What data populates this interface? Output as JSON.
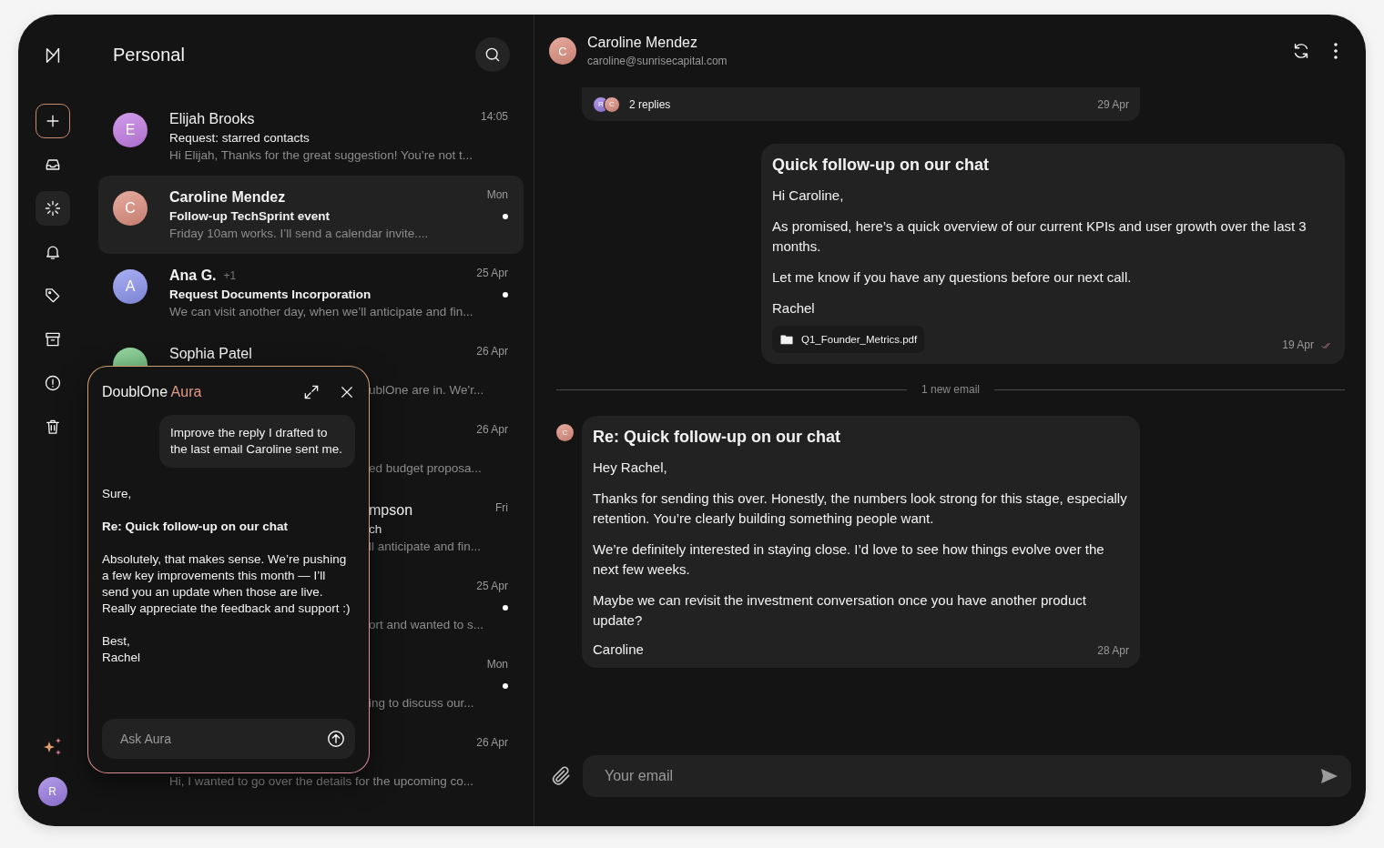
{
  "sidebar": {
    "compose": {
      "selected": false
    },
    "items": [
      {
        "selected": false
      },
      {
        "selected": true
      },
      {
        "selected": false
      },
      {
        "selected": false
      },
      {
        "selected": false
      },
      {
        "selected": false
      },
      {
        "selected": false
      }
    ],
    "user": {
      "letter": "R",
      "color": "#9a7be3"
    }
  },
  "mail_list": {
    "title": "Personal",
    "rows": [
      {
        "avatar": {
          "letter": "E",
          "color": "#c47de6"
        },
        "name": "Elijah Brooks",
        "date": "14:05",
        "subject": "Request: starred contacts",
        "preview": "Hi Elijah, Thanks for the great suggestion! You’re not t...",
        "unread": false,
        "selected": false
      },
      {
        "avatar": {
          "letter": "C",
          "color": "#e08f80"
        },
        "name": "Caroline Mendez",
        "date": "Mon",
        "subject": "Follow-up TechSprint event",
        "preview": "Friday 10am works. I’ll send a calendar invite....",
        "unread": true,
        "selected": true
      },
      {
        "avatar": {
          "letter": "A",
          "color": "#8d95ef"
        },
        "name": "Ana G.",
        "count": "+1",
        "date": "25 Apr",
        "subject": "Request Documents Incorporation",
        "preview": "We can visit another day, when we’ll anticipate and fin...",
        "unread": true,
        "selected": false
      },
      {
        "avatar": {
          "color": "#74c982"
        },
        "name": "Sophia Patel",
        "date": "26 Apr",
        "preview_tail": "ublOne are in. We'r...",
        "unread": false,
        "selected": false
      },
      {
        "date": "26 Apr",
        "preview_tail": "ed budget proposa...",
        "unread": false,
        "selected": false
      },
      {
        "name_tail": "mpson",
        "date": "Fri",
        "subject_tail": "ch",
        "preview_tail": "ll anticipate and fin...",
        "unread": false,
        "selected": false
      },
      {
        "date": "25 Apr",
        "preview_tail": "ort and wanted to s...",
        "unread": true,
        "selected": false
      },
      {
        "date": "Mon",
        "preview_tail": "ing to discuss our...",
        "unread": true,
        "selected": false
      },
      {
        "date": "26 Apr",
        "preview": "Hi, I wanted to go over the details for the upcoming co...",
        "unread": false,
        "selected": false
      }
    ]
  },
  "aura": {
    "title": "DoublOne",
    "accent": "Aura",
    "prompt": "Improve the reply I drafted to the last email Caroline sent me.",
    "reply": [
      {
        "kind": "text",
        "text": "Sure,"
      },
      {
        "kind": "subject",
        "text": "Re: Quick follow-up on our chat"
      },
      {
        "kind": "text",
        "text": "Absolutely, that makes sense. We’re pushing a few key improvements this month — I’ll send you an update when those are live. Really appreciate the feedback and support :)"
      },
      {
        "kind": "text",
        "text": "Best,\nRachel"
      }
    ],
    "input": {
      "placeholder": "Ask Aura"
    }
  },
  "conversation": {
    "contact": {
      "letter": "C",
      "color": "#e08f80",
      "name": "Caroline Mendez",
      "email": "caroline@sunrisecapital.com"
    },
    "thread": [
      {
        "kind": "collapsed",
        "avatars": [
          {
            "letter": "R",
            "color": "#9a7be3"
          },
          {
            "letter": "C",
            "color": "#e08f80"
          }
        ],
        "label": "2 replies",
        "date": "29 Apr"
      },
      {
        "kind": "sent",
        "title": "Quick follow-up on our chat",
        "body": [
          "Hi Caroline,",
          "As promised, here’s a quick overview of our current KPIs and user growth over the last 3 months.",
          "Let me know if you have any questions before our next call.",
          "Rachel"
        ],
        "attachment": "Q1_Founder_Metrics.pdf",
        "date": "19 Apr",
        "read": true
      },
      {
        "kind": "divider",
        "label": "1 new email"
      },
      {
        "kind": "received",
        "avatar": {
          "letter": "C",
          "color": "#e08f80"
        },
        "title": "Re: Quick follow-up on our chat",
        "body": [
          "Hey Rachel,",
          "Thanks for sending this over. Honestly, the numbers look strong for this stage, especially retention. You’re clearly building something people want.",
          "We’re definitely interested in staying close. I’d love to see how things evolve over the next few weeks.",
          "Maybe we can revisit the investment conversation once you have another product update?"
        ],
        "signature": "Caroline",
        "date": "28 Apr"
      }
    ],
    "composer": {
      "placeholder": "Your email"
    }
  }
}
